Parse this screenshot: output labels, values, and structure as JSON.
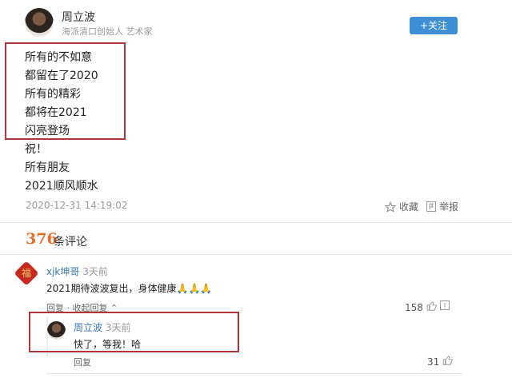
{
  "author": {
    "name": "周立波",
    "vip_mark": "|̲ ̲ ̲ ̲",
    "description": "海派清口创始人 艺术家",
    "follow_label": "+关注"
  },
  "post": {
    "lines": [
      "所有的不如意",
      "都留在了2020",
      "所有的精彩",
      "都将在2021",
      "闪亮登场",
      "祝！",
      "所有朋友",
      "2021顺风顺水"
    ],
    "timestamp": "2020-12-31 14:19:02",
    "favorite_label": "收藏",
    "report_label": "举报"
  },
  "comments_header": {
    "count": "376",
    "label": "条评论"
  },
  "comment": {
    "user": "xjk坤哥",
    "time": "3天前",
    "text": "2021期待波波复出，身体健康🙏🙏🙏",
    "reply_label": "回复",
    "collapse_label": "收起回复",
    "likes": "158",
    "avatar_glyph": "福"
  },
  "reply": {
    "user": "周立波",
    "time": "3天前",
    "text": "快了，等我！哈",
    "reply_label": "回复",
    "likes": "31"
  },
  "colors": {
    "accent_blue": "#3d8fd6",
    "highlight_red": "#b3353a",
    "count_orange": "#e86b27"
  },
  "icons": {
    "favorite": "star-outline-icon",
    "report": "flag-icon",
    "like": "thumbs-up-icon",
    "dislike": "dislike-square-icon"
  }
}
